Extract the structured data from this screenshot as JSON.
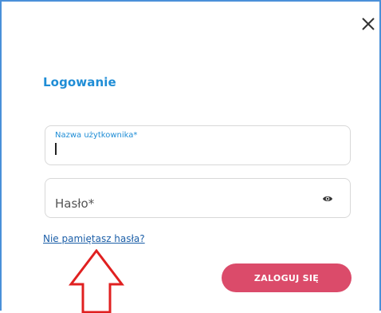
{
  "dialog": {
    "title": "Logowanie",
    "close_icon": "close-icon"
  },
  "username": {
    "label": "Nazwa użytkownika*",
    "value": ""
  },
  "password": {
    "placeholder": "Hasło*",
    "toggle_icon": "eye-icon"
  },
  "links": {
    "forgot_password": "Nie pamiętasz hasła?"
  },
  "actions": {
    "login_label": "ZALOGUJ SIĘ"
  },
  "annotation": {
    "arrow_icon": "up-arrow-icon",
    "arrow_color": "#e02020"
  },
  "colors": {
    "accent": "#1f8dd6",
    "button": "#db4b6a",
    "link": "#1c5fa8"
  }
}
